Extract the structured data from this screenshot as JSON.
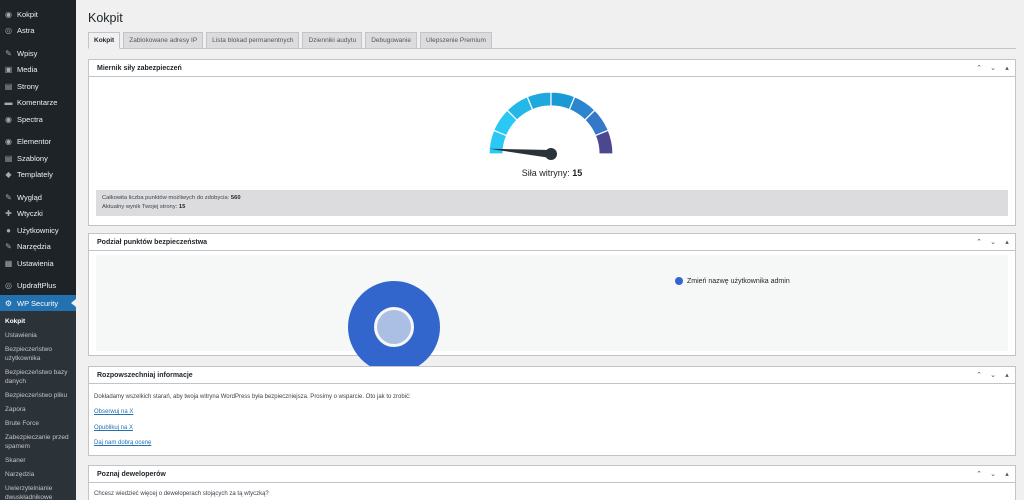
{
  "sidebar": {
    "items": [
      {
        "label": "Kokpit",
        "icon": "dashboard-icon",
        "glyph": "◉"
      },
      {
        "label": "Astra",
        "icon": "astra-icon",
        "glyph": "◎"
      },
      {
        "sep": true
      },
      {
        "label": "Wpisy",
        "icon": "pin-icon",
        "glyph": "✎"
      },
      {
        "label": "Media",
        "icon": "media-icon",
        "glyph": "▣"
      },
      {
        "label": "Strony",
        "icon": "pages-icon",
        "glyph": "▤"
      },
      {
        "label": "Komentarze",
        "icon": "comments-icon",
        "glyph": "▬"
      },
      {
        "label": "Spectra",
        "icon": "spectra-icon",
        "glyph": "◉"
      },
      {
        "sep": true
      },
      {
        "label": "Elementor",
        "icon": "elementor-icon",
        "glyph": "◉"
      },
      {
        "label": "Szablony",
        "icon": "templates-icon",
        "glyph": "▤"
      },
      {
        "label": "Templately",
        "icon": "templately-icon",
        "glyph": "◆"
      },
      {
        "sep": true
      },
      {
        "label": "Wygląd",
        "icon": "appearance-icon",
        "glyph": "✎"
      },
      {
        "label": "Wtyczki",
        "icon": "plugins-icon",
        "glyph": "✚"
      },
      {
        "label": "Użytkownicy",
        "icon": "users-icon",
        "glyph": "●"
      },
      {
        "label": "Narzędzia",
        "icon": "tools-icon",
        "glyph": "✎"
      },
      {
        "label": "Ustawienia",
        "icon": "settings-icon",
        "glyph": "▦"
      },
      {
        "sep": true
      },
      {
        "label": "UpdraftPlus",
        "icon": "updraft-icon",
        "glyph": "◎"
      }
    ],
    "active": {
      "label": "WP Security",
      "icon": "shield-icon",
      "glyph": "⚙"
    },
    "submenu": [
      "Kokpit",
      "Ustawienia",
      "Bezpieczeństwo użytkownika",
      "Bezpieczeństwo bazy danych",
      "Bezpieczeństwo pliku",
      "Zapora",
      "Brute Force",
      "Zabezpieczanie przed spamem",
      "Skaner",
      "Narzędzia",
      "Uwierzytelnianie dwuskładnikowe"
    ]
  },
  "page": {
    "title": "Kokpit",
    "tabs": [
      "Kokpit",
      "Zablokowane adresy IP",
      "Lista blokad permanentnych",
      "Dzienniki audytu",
      "Debugowanie",
      "Ulepszenie Premium"
    ]
  },
  "gauge_box": {
    "title": "Miernik siły zabezpieczeń",
    "caption_label": "Siła witryny:",
    "score": 15,
    "max": 560,
    "total_label": "Całkowita liczba punktów możliwych do zdobycia:",
    "total_value": "560",
    "current_label": "Aktualny wynik Twojej strony:",
    "current_value": "15",
    "colors": [
      "#29c8f5",
      "#29c8f5",
      "#23b8e8",
      "#1ea8dd",
      "#1a9ad5",
      "#2c86cf",
      "#3578c8",
      "#4b4891"
    ]
  },
  "breakdown_box": {
    "title": "Podział punktów bezpieczeństwa",
    "legend": "Zmień nazwę użytkownika admin",
    "slices": [
      {
        "label": "Zmień nazwę użytkownika admin",
        "value": 100,
        "color": "#3366cc"
      }
    ]
  },
  "share_box": {
    "title": "Rozpowszechniaj informacje",
    "text": "Dokładamy wszelkich starań, aby twoja witryna WordPress była bezpieczniejsza. Prosimy o wsparcie. Oto jak to zrobić:",
    "links": [
      "Obserwuj na X",
      "Opublikuj na X",
      "Daj nam dobrą ocenę"
    ]
  },
  "dev_box": {
    "title": "Poznaj deweloperów",
    "text": "Chcesz wiedzieć więcej o deweloperach stojących za tą wtyczką?"
  },
  "controls": {
    "up": "⌃",
    "down": "⌄",
    "toggle": "▴"
  }
}
